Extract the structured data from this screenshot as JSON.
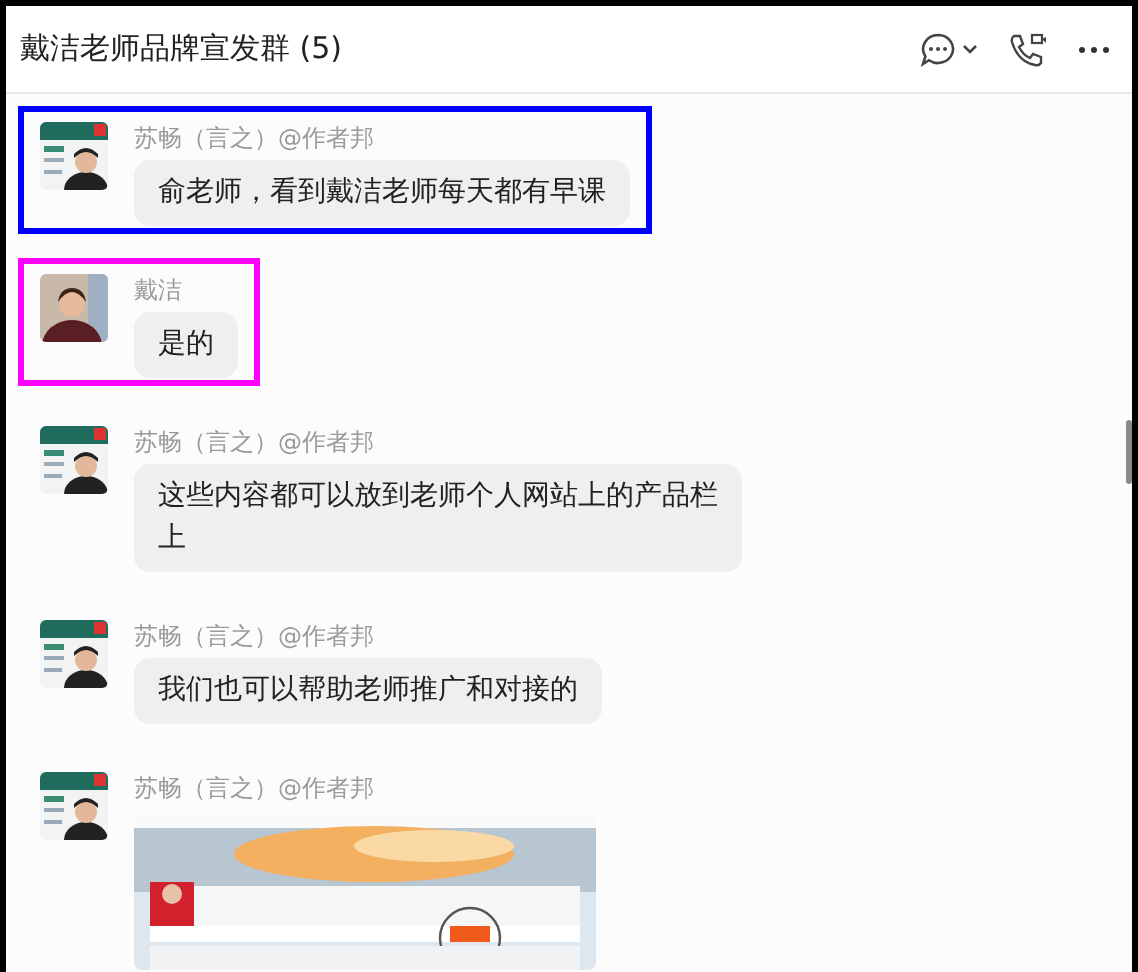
{
  "window": {
    "title": "戴洁老师品牌宣发群 (5)"
  },
  "messages": [
    {
      "kind": "text",
      "sender": "苏畅（言之）@作者邦",
      "text": "俞老师，看到戴洁老师每天都有早课",
      "color": "#0000ff"
    },
    {
      "kind": "text",
      "sender": "戴洁",
      "text": "是的",
      "color": "#ff00ff"
    },
    {
      "kind": "text",
      "sender": "苏畅（言之）@作者邦",
      "text": "这些内容都可以放到老师个人网站上的产品栏上"
    },
    {
      "kind": "text",
      "sender": "苏畅（言之）@作者邦",
      "text": "我们也可以帮助老师推广和对接的"
    },
    {
      "kind": "picture",
      "sender": "苏畅（言之）@作者邦"
    }
  ]
}
